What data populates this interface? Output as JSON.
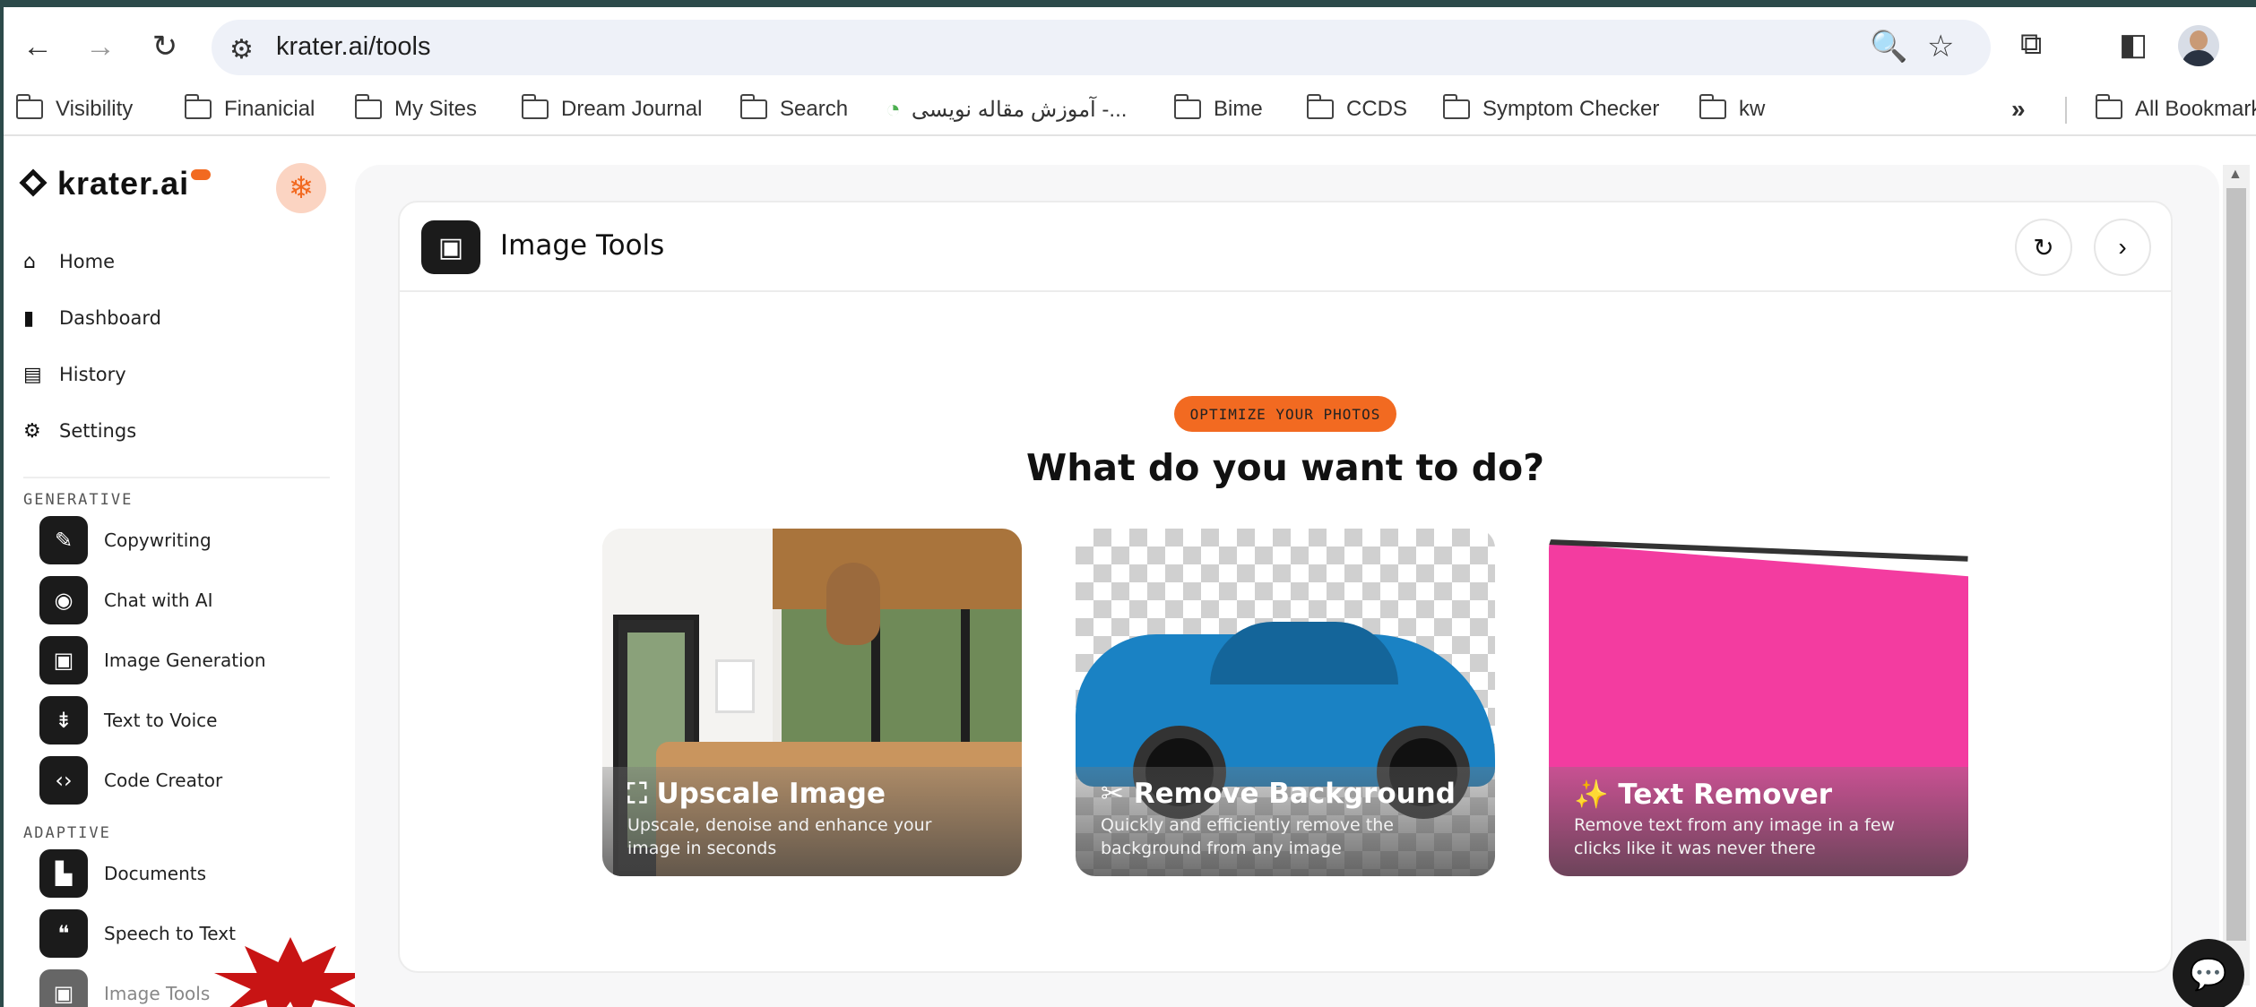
{
  "browser": {
    "url": "krater.ai/tools",
    "bookmarks": [
      {
        "label": "Visibility",
        "type": "folder"
      },
      {
        "label": "Finanicial",
        "type": "folder"
      },
      {
        "label": "My Sites",
        "type": "folder"
      },
      {
        "label": "Dream Journal",
        "type": "folder"
      },
      {
        "label": "Search",
        "type": "folder"
      },
      {
        "label": "آموزش مقاله نویسی -...",
        "type": "site"
      },
      {
        "label": "Bime",
        "type": "folder"
      },
      {
        "label": "CCDS",
        "type": "folder"
      },
      {
        "label": "Symptom Checker",
        "type": "folder"
      },
      {
        "label": "kw",
        "type": "folder"
      }
    ],
    "overflow": "»",
    "all_bookmarks": "All Bookmarks"
  },
  "sidebar": {
    "logo": "krater.ai",
    "nav": [
      {
        "label": "Home",
        "icon": "home-icon"
      },
      {
        "label": "Dashboard",
        "icon": "bar-chart-icon"
      },
      {
        "label": "History",
        "icon": "archive-icon"
      },
      {
        "label": "Settings",
        "icon": "gear-icon"
      }
    ],
    "generative_title": "GENERATIVE",
    "generative": [
      {
        "label": "Copywriting",
        "icon": "pencil-icon"
      },
      {
        "label": "Chat with AI",
        "icon": "chat-bubble-icon"
      },
      {
        "label": "Image Generation",
        "icon": "image-icon"
      },
      {
        "label": "Text to Voice",
        "icon": "microphone-icon"
      },
      {
        "label": "Code Creator",
        "icon": "code-icon"
      }
    ],
    "adaptive_title": "ADAPTIVE",
    "adaptive": [
      {
        "label": "Documents",
        "icon": "document-icon"
      },
      {
        "label": "Speech to Text",
        "icon": "quote-icon"
      },
      {
        "label": "Image Tools",
        "icon": "image-tools-icon"
      }
    ]
  },
  "main": {
    "title": "Image Tools",
    "badge": "OPTIMIZE YOUR PHOTOS",
    "heading": "What do you want to do?",
    "cards": [
      {
        "title": "Upscale Image",
        "icon": "expand-icon",
        "desc": "Upscale, denoise and enhance your image in seconds"
      },
      {
        "title": "Remove Background",
        "icon": "scissors-icon",
        "desc": "Quickly and efficiently remove the background from any image"
      },
      {
        "title": "Text Remover",
        "icon": "magic-wand-icon",
        "desc": "Remove text from any image in a few clicks like it was never there"
      }
    ]
  },
  "colors": {
    "accent": "#f26a21",
    "dark": "#1b1b1b"
  }
}
